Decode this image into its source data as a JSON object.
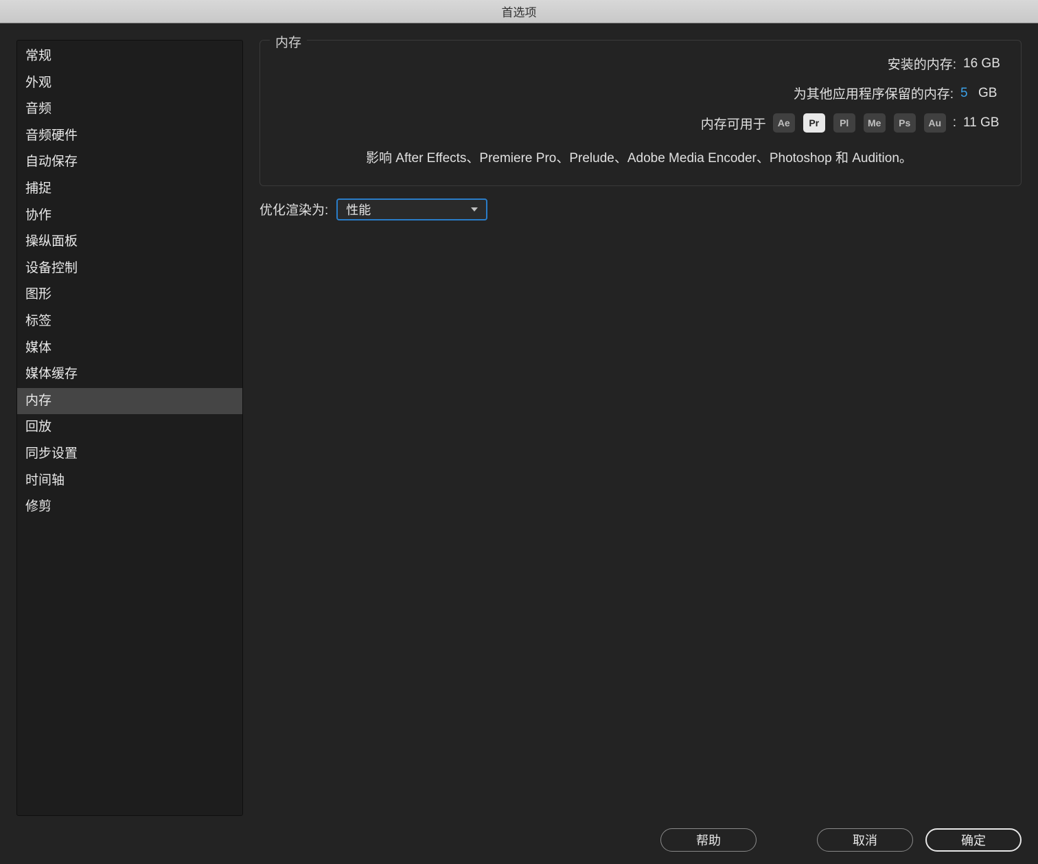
{
  "window": {
    "title": "首选项"
  },
  "sidebar": {
    "items": [
      {
        "label": "常规"
      },
      {
        "label": "外观"
      },
      {
        "label": "音频"
      },
      {
        "label": "音频硬件"
      },
      {
        "label": "自动保存"
      },
      {
        "label": "捕捉"
      },
      {
        "label": "协作"
      },
      {
        "label": "操纵面板"
      },
      {
        "label": "设备控制"
      },
      {
        "label": "图形"
      },
      {
        "label": "标签"
      },
      {
        "label": "媒体"
      },
      {
        "label": "媒体缓存"
      },
      {
        "label": "内存"
      },
      {
        "label": "回放"
      },
      {
        "label": "同步设置"
      },
      {
        "label": "时间轴"
      },
      {
        "label": "修剪"
      }
    ],
    "selected_index": 13
  },
  "memory_panel": {
    "legend": "内存",
    "installed_label": "安装的内存:",
    "installed_value": "16 GB",
    "reserved_label": "为其他应用程序保留的内存:",
    "reserved_value_num": "5",
    "reserved_value_unit": "GB",
    "available_label": "内存可用于",
    "available_suffix": ":",
    "available_value": "11 GB",
    "app_badges": [
      {
        "code": "Ae",
        "style": "dark"
      },
      {
        "code": "Pr",
        "style": "light"
      },
      {
        "code": "Pl",
        "style": "dark"
      },
      {
        "code": "Me",
        "style": "dark"
      },
      {
        "code": "Ps",
        "style": "dark"
      },
      {
        "code": "Au",
        "style": "dark"
      }
    ],
    "description": "影响 After Effects、Premiere Pro、Prelude、Adobe Media Encoder、Photoshop 和 Audition。"
  },
  "render_row": {
    "label": "优化渲染为:",
    "selected": "性能"
  },
  "footer": {
    "help": "帮助",
    "cancel": "取消",
    "ok": "确定"
  }
}
